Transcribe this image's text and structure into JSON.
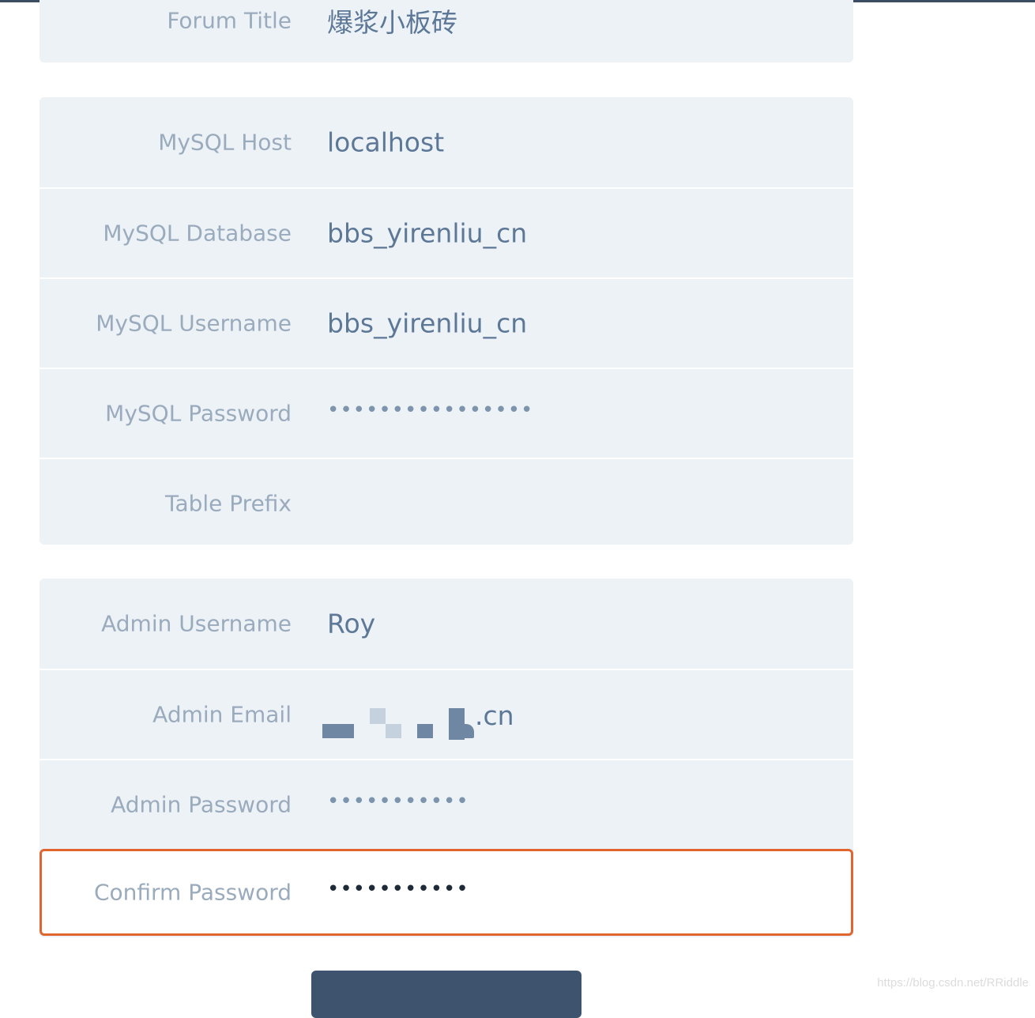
{
  "forum": {
    "title_label": "Forum Title",
    "title_value": "爆浆小板砖"
  },
  "mysql": {
    "host_label": "MySQL Host",
    "host_value": "localhost",
    "database_label": "MySQL Database",
    "database_value": "bbs_yirenliu_cn",
    "username_label": "MySQL Username",
    "username_value": "bbs_yirenliu_cn",
    "password_label": "MySQL Password",
    "password_value": "••••••••••••••••",
    "prefix_label": "Table Prefix",
    "prefix_value": ""
  },
  "admin": {
    "username_label": "Admin Username",
    "username_value": "Roy",
    "email_label": "Admin Email",
    "email_visible_suffix": ".cn",
    "password_label": "Admin Password",
    "password_value": "•••••••••••",
    "confirm_label": "Confirm Password",
    "confirm_value": "•••••••••••"
  },
  "colors": {
    "accent_focus": "#e0652f",
    "button": "#3e546e",
    "panel": "#edf2f7"
  },
  "watermark": "https://blog.csdn.net/RRiddle"
}
